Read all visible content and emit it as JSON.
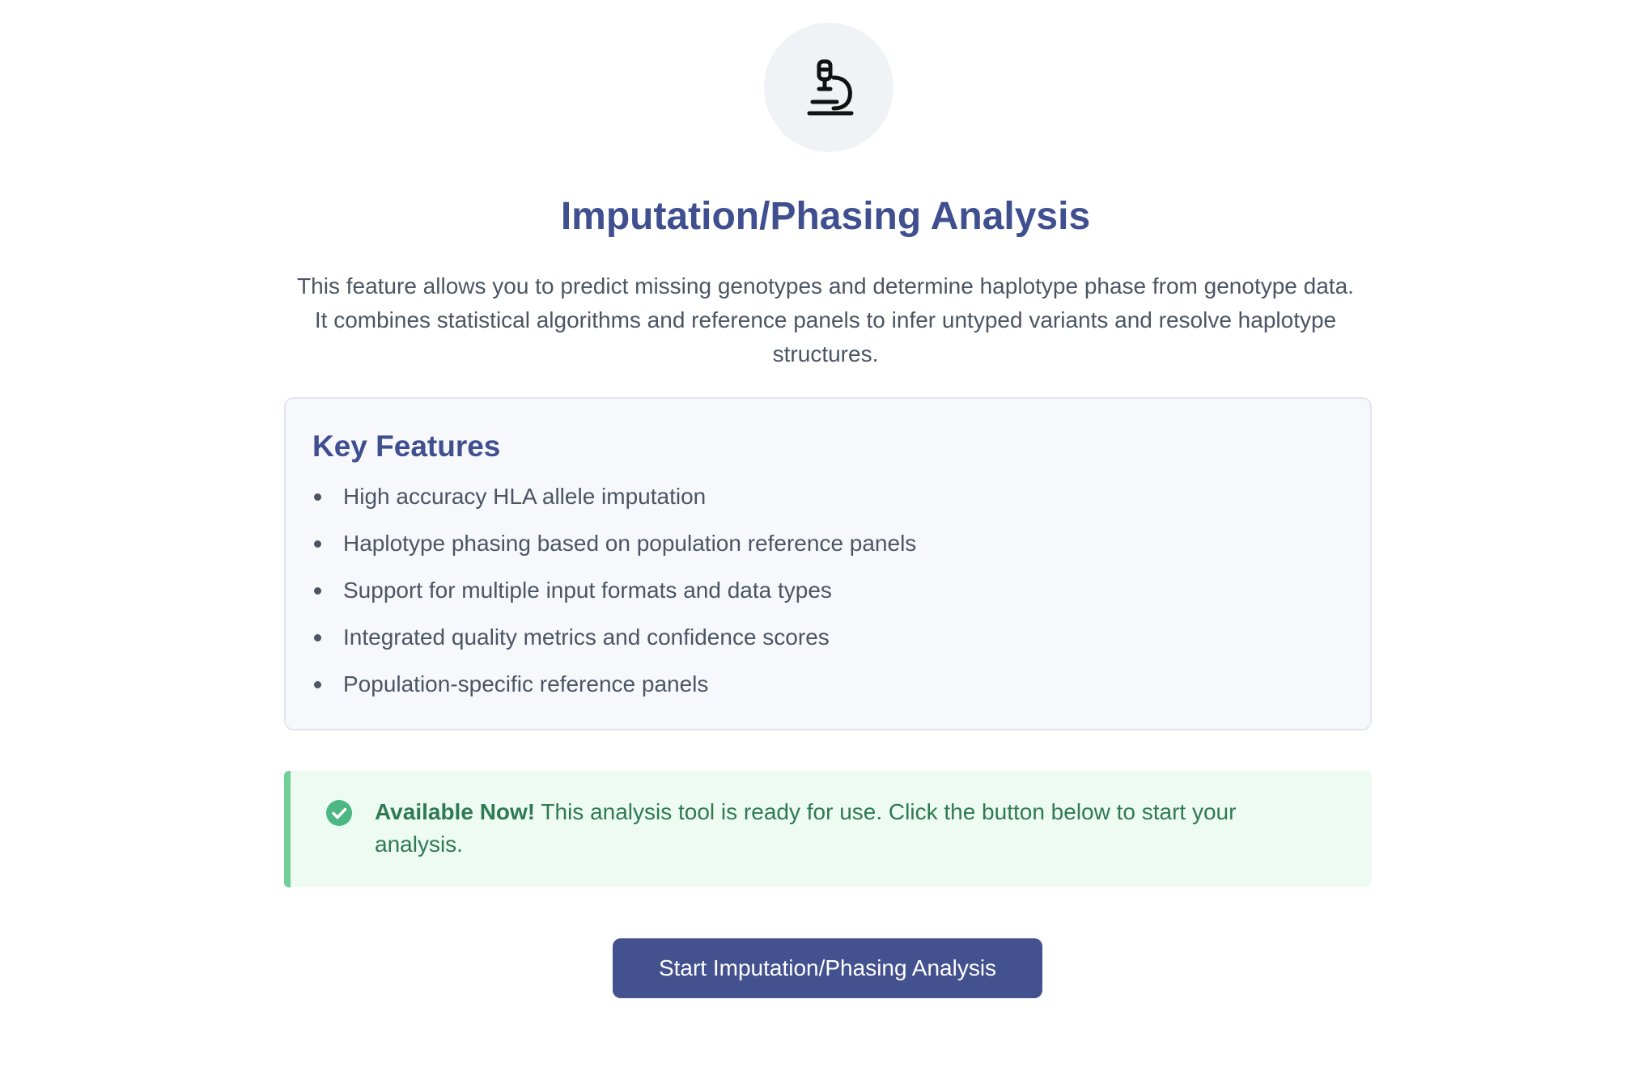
{
  "header": {
    "icon": "microscope-icon",
    "title": "Imputation/Phasing Analysis"
  },
  "description": "This feature allows you to predict missing genotypes and determine haplotype phase from genotype data. It combines statistical algorithms and reference panels to infer untyped variants and resolve haplotype structures.",
  "features": {
    "title": "Key Features",
    "items": [
      "High accuracy HLA allele imputation",
      "Haplotype phasing based on population reference panels",
      "Support for multiple input formats and data types",
      "Integrated quality metrics and confidence scores",
      "Population-specific reference panels"
    ]
  },
  "notice": {
    "icon": "check-circle-icon",
    "bold": "Available Now!",
    "text": " This analysis tool is ready for use. Click the button below to start your analysis."
  },
  "action": {
    "button_label": "Start Imputation/Phasing Analysis"
  },
  "colors": {
    "accent": "#43518f",
    "title": "#3f4f8f",
    "success": "#2f7a52",
    "success_bg": "#edfbf3",
    "success_border": "#6fcf97"
  }
}
